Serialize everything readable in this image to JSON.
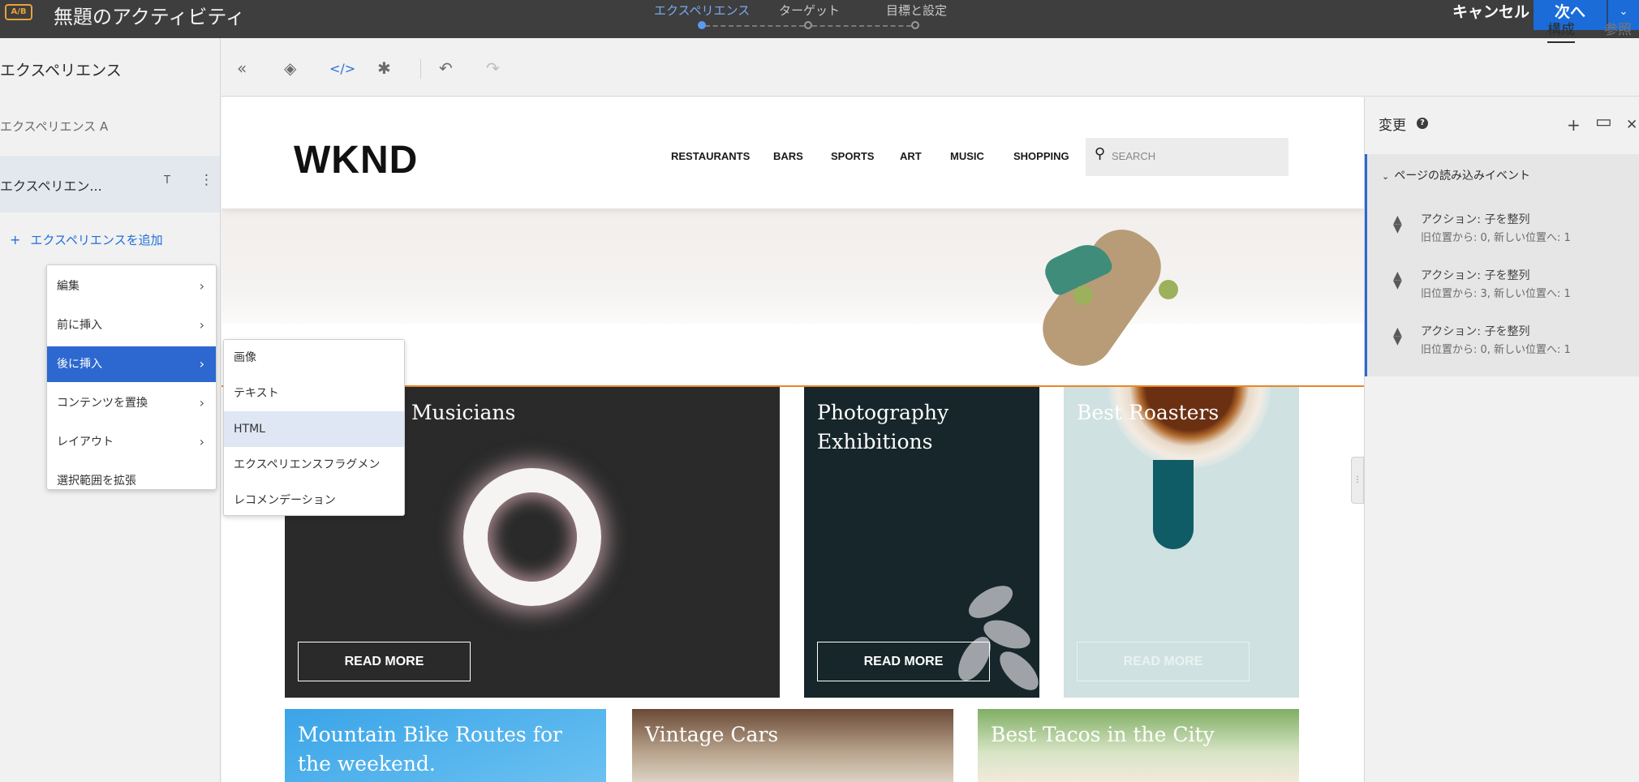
{
  "topbar": {
    "badge": "A/B",
    "title": "無題のアクティビティ",
    "steps": [
      {
        "label": "エクスペリエンス",
        "active": true
      },
      {
        "label": "ターゲット",
        "active": false
      },
      {
        "label": "目標と設定",
        "active": false
      }
    ],
    "cancel_label": "キャンセル",
    "next_label": "次へ",
    "next_caret": "⌄"
  },
  "left_panel": {
    "title": "エクスペリエンス",
    "experience_a": "エクスペリエンス A",
    "experience_b_truncated": "エクスペリエン...",
    "rename_icon_text": "T",
    "more_icon_text": "⋮",
    "add_experience": "エクスペリエンスを追加",
    "add_plus": "+"
  },
  "context_menu": {
    "items": [
      {
        "label": "編集",
        "submenu": true,
        "selected": false
      },
      {
        "label": "前に挿入",
        "submenu": true,
        "selected": false
      },
      {
        "label": "後に挿入",
        "submenu": true,
        "selected": true
      },
      {
        "label": "コンテンツを置換",
        "submenu": true,
        "selected": false
      },
      {
        "label": "レイアウト",
        "submenu": true,
        "selected": false
      },
      {
        "label": "選択範囲を拡張",
        "submenu": false,
        "selected": false
      }
    ],
    "submenu_items": [
      {
        "label": "画像",
        "hover": false
      },
      {
        "label": "テキスト",
        "hover": false
      },
      {
        "label": "HTML",
        "hover": true
      },
      {
        "label": "エクスペリエンスフラグメン",
        "hover": false
      },
      {
        "label": "レコメンデーション",
        "hover": false
      }
    ],
    "chevron": "›"
  },
  "toolbar": {
    "icons": [
      {
        "name": "collapse-left-icon",
        "glyph": "«"
      },
      {
        "name": "layers-icon",
        "glyph": "◈"
      },
      {
        "name": "code-icon",
        "glyph": "</>"
      },
      {
        "name": "settings-icon",
        "glyph": "✱"
      },
      {
        "name": "undo-icon",
        "glyph": "↶"
      },
      {
        "name": "redo-icon",
        "glyph": "↷"
      }
    ],
    "tab_compose": "構成",
    "tab_browse": "参照"
  },
  "site": {
    "logo": "WKND",
    "nav": [
      "RESTAURANTS",
      "BARS",
      "SPORTS",
      "ART",
      "MUSIC",
      "SHOPPING"
    ],
    "search_placeholder": "SEARCH",
    "cards": [
      {
        "title": "d Musicians",
        "button": "READ MORE"
      },
      {
        "title": "Photography Exhibitions",
        "button": "READ MORE"
      },
      {
        "title": "Best Roasters",
        "button": "READ MORE"
      },
      {
        "title": "Mountain Bike Routes for the weekend.",
        "button": ""
      },
      {
        "title": "Vintage Cars",
        "button": ""
      },
      {
        "title": "Best Tacos in the City",
        "button": ""
      }
    ]
  },
  "right_panel": {
    "title": "変更",
    "help": "?",
    "add_icon": "+",
    "layout_icon": "▭",
    "close_icon": "✕",
    "section_title": "ページの読み込みイベント",
    "section_chev": "⌄",
    "actions": [
      {
        "title": "アクション: 子を整列",
        "detail": "旧位置から: 0, 新しい位置へ: 1"
      },
      {
        "title": "アクション: 子を整列",
        "detail": "旧位置から: 3, 新しい位置へ: 1"
      },
      {
        "title": "アクション: 子を整列",
        "detail": "旧位置から: 0, 新しい位置へ: 1"
      }
    ]
  },
  "colors": {
    "accent_blue": "#2c68cf",
    "topbar_bg": "#3e3e3e",
    "badge_orange": "#e8a23a",
    "selection_orange": "#e8862a"
  }
}
